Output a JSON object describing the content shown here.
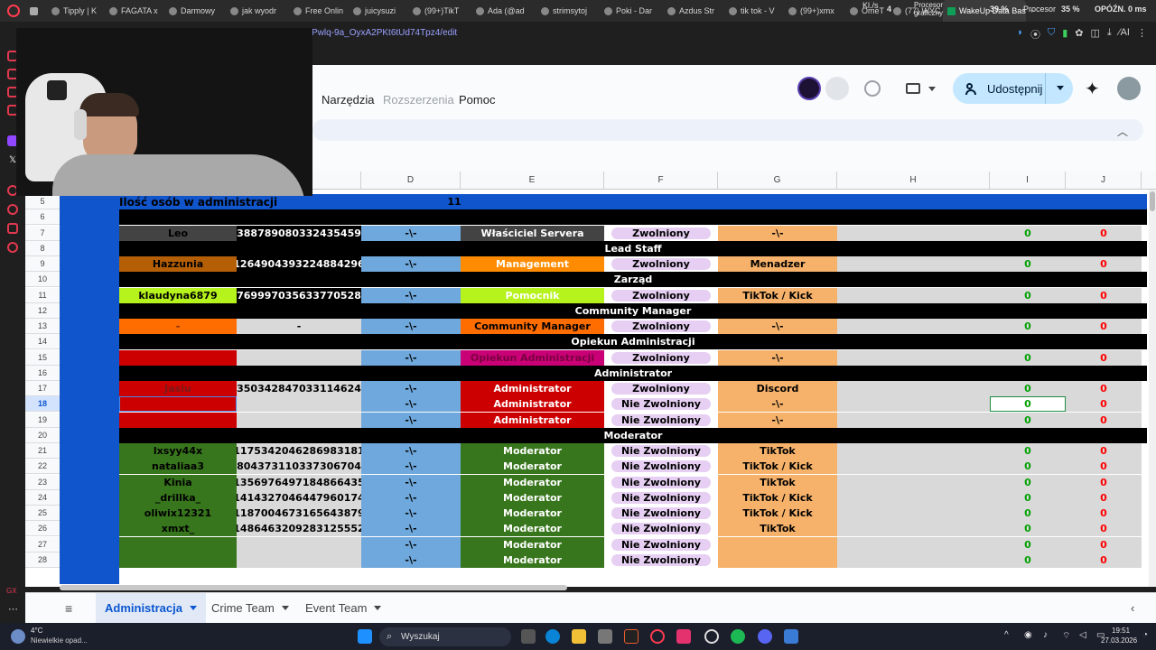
{
  "browser": {
    "tabs": [
      "Tipply | K",
      "FAGATA x",
      "Darmowy",
      "jak wyodr",
      "Free Onlin",
      "juicysuzi",
      "(99+)TikT",
      "Ada (@ad",
      "strimsytoj",
      "Poki - Dar",
      "Azdus Str",
      "tik tok - V",
      "(99+)xmx",
      "OmeT",
      "(77) WYC",
      "WakeUp Data Base"
    ],
    "url_fragment": "Pwlq-9a_OyxA2PKt6tUd74Tpz4/edit",
    "stats": {
      "kl_label": "Kl./s",
      "kl_value": "4",
      "gpu_label": "Procesor graficzny",
      "gpu_value": "39 %",
      "cpu_label": "Procesor",
      "cpu_value": "35 %",
      "delay_label": "OPÓŹN.",
      "delay_value": "0 ms"
    },
    "ai_label": "AI"
  },
  "docs": {
    "menus": [
      "Narzędzia",
      "Rozszerzenia",
      "Pomoc"
    ],
    "share_label": "Udostępnij"
  },
  "columns": [
    "D",
    "E",
    "F",
    "G",
    "H",
    "I",
    "J"
  ],
  "rows": [
    {
      "num": "5",
      "kind": "header",
      "a": "Ilość osób w administracji",
      "d": "11"
    },
    {
      "num": "6",
      "kind": "black"
    },
    {
      "num": "7",
      "kind": "data",
      "a": "Leo",
      "b": "388789080332435459",
      "c": "-\\-",
      "e": "Właściciel Servera",
      "f": "Zwolniony",
      "g": "-\\-",
      "i": "0",
      "j": "0"
    },
    {
      "num": "8",
      "kind": "section",
      "label": "Lead Staff"
    },
    {
      "num": "9",
      "kind": "data",
      "a": "Hazzunia",
      "b": "1264904393224884296",
      "c": "-\\-",
      "e": "Management",
      "f": "Zwolniony",
      "g": "Menadzer",
      "i": "0",
      "j": "0"
    },
    {
      "num": "10",
      "kind": "section",
      "label": "Zarząd"
    },
    {
      "num": "11",
      "kind": "data",
      "a": "klaudyna6879",
      "b": "769997035633770528",
      "c": "-\\-",
      "e": "Pomocnik",
      "f": "Zwolniony",
      "g": "TikTok / Kick",
      "i": "0",
      "j": "0"
    },
    {
      "num": "12",
      "kind": "section",
      "label": "Community Manager"
    },
    {
      "num": "13",
      "kind": "data",
      "a": "-",
      "b": "-",
      "c": "-\\-",
      "e": "Community Manager",
      "f": "Zwolniony",
      "g": "-\\-",
      "i": "0",
      "j": "0"
    },
    {
      "num": "14",
      "kind": "section",
      "label": "Opiekun Administracji"
    },
    {
      "num": "15",
      "kind": "data",
      "a": "",
      "b": "",
      "c": "-\\-",
      "e": "Opiekun Administracji",
      "f": "Zwolniony",
      "g": "-\\-",
      "i": "0",
      "j": "0"
    },
    {
      "num": "16",
      "kind": "section",
      "label": "Administrator"
    },
    {
      "num": "17",
      "kind": "data",
      "a": "Jasiu",
      "b": "350342847033114624",
      "c": "-\\-",
      "e": "Administrator",
      "f": "Zwolniony",
      "g": "Discord",
      "i": "0",
      "j": "0"
    },
    {
      "num": "18",
      "kind": "data",
      "a": "",
      "b": "",
      "c": "-\\-",
      "e": "Administrator",
      "f": "Nie Zwolniony",
      "g": "-\\-",
      "i": "0",
      "j": "0"
    },
    {
      "num": "19",
      "kind": "data",
      "a": "",
      "b": "",
      "c": "-\\-",
      "e": "Administrator",
      "f": "Nie Zwolniony",
      "g": "-\\-",
      "i": "0",
      "j": "0"
    },
    {
      "num": "20",
      "kind": "section",
      "label": "Moderator"
    },
    {
      "num": "21",
      "kind": "data",
      "a": "lxsyy44x",
      "b": "1175342046286983181",
      "c": "-\\-",
      "e": "Moderator",
      "f": "Nie Zwolniony",
      "g": "TikTok",
      "i": "0",
      "j": "0"
    },
    {
      "num": "22",
      "kind": "data",
      "a": "nataliaa3",
      "b": "804373110337306704",
      "c": "-\\-",
      "e": "Moderator",
      "f": "Nie Zwolniony",
      "g": "TikTok / Kick",
      "i": "0",
      "j": "0"
    },
    {
      "num": "23",
      "kind": "data",
      "a": "Kinia",
      "b": "1356976497184866435",
      "c": "-\\-",
      "e": "Moderator",
      "f": "Nie Zwolniony",
      "g": "TikTok",
      "i": "0",
      "j": "0"
    },
    {
      "num": "24",
      "kind": "data",
      "a": "_drillka_",
      "b": "1414327046447960174",
      "c": "-\\-",
      "e": "Moderator",
      "f": "Nie Zwolniony",
      "g": "TikTok / Kick",
      "i": "0",
      "j": "0"
    },
    {
      "num": "25",
      "kind": "data",
      "a": "oliwix12321",
      "b": "1187004673165643879",
      "c": "-\\-",
      "e": "Moderator",
      "f": "Nie Zwolniony",
      "g": "TikTok / Kick",
      "i": "0",
      "j": "0"
    },
    {
      "num": "26",
      "kind": "data",
      "a": "xmxt_",
      "b": "1486463209283125552",
      "c": "-\\-",
      "e": "Moderator",
      "f": "Nie Zwolniony",
      "g": "TikTok",
      "i": "0",
      "j": "0"
    },
    {
      "num": "27",
      "kind": "data",
      "a": "",
      "b": "",
      "c": "-\\-",
      "e": "Moderator",
      "f": "Nie Zwolniony",
      "g": "",
      "i": "0",
      "j": "0"
    },
    {
      "num": "28",
      "kind": "data",
      "a": "",
      "b": "",
      "c": "-\\-",
      "e": "Moderator",
      "f": "Nie Zwolniony",
      "g": "",
      "i": "0",
      "j": "0"
    }
  ],
  "sheets": {
    "tabs": [
      "Administracja",
      "Crime Team",
      "Event Team"
    ],
    "active": "Administracja"
  },
  "taskbar": {
    "weather_temp": "4°C",
    "weather_desc": "Niewielkie opad...",
    "search_placeholder": "Wyszukaj",
    "time": "19:51",
    "date": "27.03.2026"
  },
  "colors": {
    "header_blue": "#1155cc",
    "left_blue": "#1155cc",
    "col_c_blue": "#6fa8dc",
    "status_pill": "#e6cff2",
    "col_g_orange": "#f6b26b",
    "green_text": "#00a000",
    "red_text": "#ff0000",
    "moderator_green": "#38761d",
    "admin_red": "#cc0000",
    "management_orange": "#e69138",
    "pomocnik_lime": "#b6f21b",
    "cm_orange": "#ff6d01",
    "opiekun_magenta": "#c90076",
    "sheets_accent": "#0b57d0"
  }
}
